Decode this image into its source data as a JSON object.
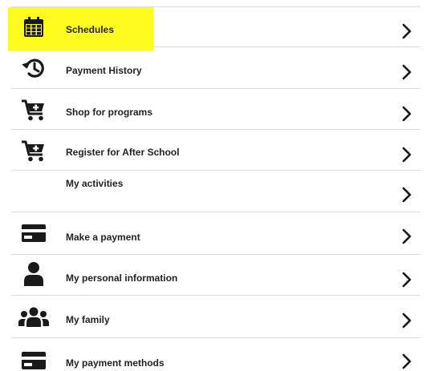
{
  "colors": {
    "highlight": "#fffa1f",
    "text": "#222222",
    "icon": "#1a1a1a",
    "divider": "#dcdcdc"
  },
  "menu": {
    "items": [
      {
        "label": "Schedules",
        "icon": "calendar-icon",
        "highlighted": true
      },
      {
        "label": "Payment History",
        "icon": "history-icon"
      },
      {
        "label": "Shop for programs",
        "icon": "cart-plus-icon"
      },
      {
        "label": "Register for After School",
        "icon": "cart-plus-icon"
      },
      {
        "label": "My activities",
        "icon": ""
      },
      {
        "label": "Make a payment",
        "icon": "credit-card-icon"
      },
      {
        "label": "My personal information",
        "icon": "person-icon"
      },
      {
        "label": "My family",
        "icon": "group-icon"
      },
      {
        "label": "My payment methods",
        "icon": "credit-card-icon"
      }
    ]
  }
}
